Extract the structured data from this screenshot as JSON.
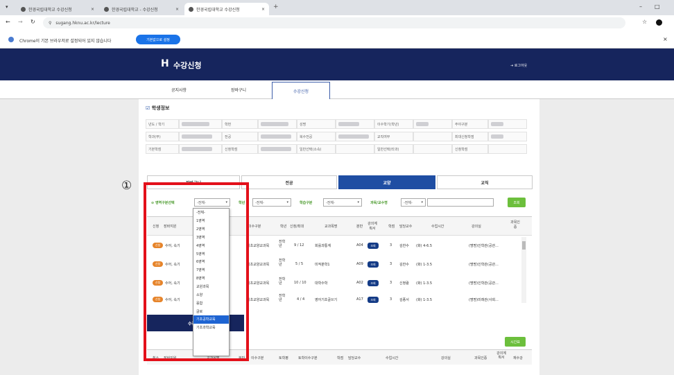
{
  "browser": {
    "tabs": [
      {
        "title": "한경국립대학교 수강신청"
      },
      {
        "title": "한경국립대학교 - 수강신청"
      },
      {
        "title": "한경국립대학교 수강신청",
        "active": true
      }
    ],
    "new_tab": "+",
    "url": "sugang.hknu.ac.kr/lecture",
    "window_controls": [
      "–",
      "□"
    ],
    "info_text": "Chrome이 기본 브라우저로 설정되어 있지 않습니다",
    "info_button": "기본값으로 설정",
    "info_close": "×"
  },
  "header": {
    "logo_mark": "H",
    "title": "수강신청",
    "logout": "로그아웃"
  },
  "nav": {
    "tabs": [
      "공지사항",
      "장바구니",
      "수강신청"
    ],
    "active": 2
  },
  "student_info": {
    "heading": "학생정보",
    "rows": [
      [
        "년도 / 학기",
        "학번",
        "성명",
        "이수학기(학년)",
        "주야구분"
      ],
      [
        "학과(부)",
        "전공",
        "복수전공",
        "교직여부",
        "최대신청학점"
      ],
      [
        "기본학점",
        "신청학점",
        "일반선택(소속)",
        "일반선택(타과)",
        "신청학점"
      ]
    ]
  },
  "category_tabs": [
    "장바구니",
    "전공",
    "교양",
    "교직"
  ],
  "active_category": 2,
  "filters": {
    "area_label": "영역구분선택",
    "area_value": "-전체-",
    "grade_label": "학년",
    "grade_value": "-전체-",
    "type_label": "학습구분",
    "type_value": "-전체-",
    "subject_label": "과목/교수명",
    "subject_value": "-전체-",
    "search_button": "조회"
  },
  "table": {
    "headers": [
      "신청",
      "장바지원",
      "교과목명",
      "주간",
      "이수구분",
      "학년",
      "신청/최대",
      "교과목명",
      "분반",
      "강의계획서",
      "학점",
      "담당교수",
      "수업시간",
      "강의실",
      "과목인증"
    ],
    "rows": [
      {
        "apply": "신청",
        "name_short": "수어, 속기",
        "type": "기초교양교과목",
        "grade": "전학년",
        "count": "9 / 12",
        "course": "회를과통계",
        "section": "A04",
        "plan": "조회",
        "credit": "3",
        "prof": "김한수",
        "time": "(화) 4-6.5",
        "room": "(명명)인학관(공관..."
      },
      {
        "apply": "신청",
        "name_short": "수어, 속기",
        "type": "기초교양교과목",
        "grade": "전학년",
        "count": "5 / 5",
        "course": "미적분학1",
        "section": "A09",
        "plan": "조회",
        "credit": "3",
        "prof": "김한수",
        "time": "(화) 1-3.5",
        "room": "(명명)인학관(공관..."
      },
      {
        "apply": "신청",
        "name_short": "수어, 속기",
        "type": "기초교양교과목",
        "grade": "전학년",
        "count": "10 / 10",
        "course": "대학수학",
        "section": "A02",
        "plan": "조회",
        "credit": "3",
        "prof": "신정람",
        "time": "(화) 1-3.5",
        "room": "(명명)인학관(공관..."
      },
      {
        "apply": "신청",
        "name_short": "수어, 속기",
        "type": "기초교양교과목",
        "grade": "전학년",
        "count": "4 / 4",
        "course": "영어기초글쓰기",
        "section": "A17",
        "plan": "조회",
        "credit": "3",
        "prof": "김종서",
        "time": "(화) 1-3.5",
        "room": "(명명)미래관(사회..."
      }
    ]
  },
  "dropdown": {
    "options": [
      "-전체-",
      "1영역",
      "2영역",
      "3영역",
      "4영역",
      "5영역",
      "6영역",
      "7영역",
      "8영역",
      "교원과목",
      "소양",
      "융합",
      "글로",
      "기초공학교육",
      "기초과학교육"
    ],
    "highlighted": 13
  },
  "bottom": {
    "history_title": "수강신청",
    "time_button": "시간표",
    "headers": [
      "취소",
      "장바지원",
      "교과목명",
      "분반",
      "이수구분",
      "토학평",
      "토학이수구분",
      "학점",
      "담당교수",
      "수업시간",
      "강의실",
      "과목인증",
      "강의계획서",
      "재수강"
    ]
  },
  "annotation": {
    "marker": "①"
  },
  "colors": {
    "accent": "#1f4ea3",
    "header": "#16255d",
    "apply": "#e6842a",
    "highlight": "#1e64d2",
    "annotation": "#e3101a",
    "search": "#6cbf3c"
  }
}
